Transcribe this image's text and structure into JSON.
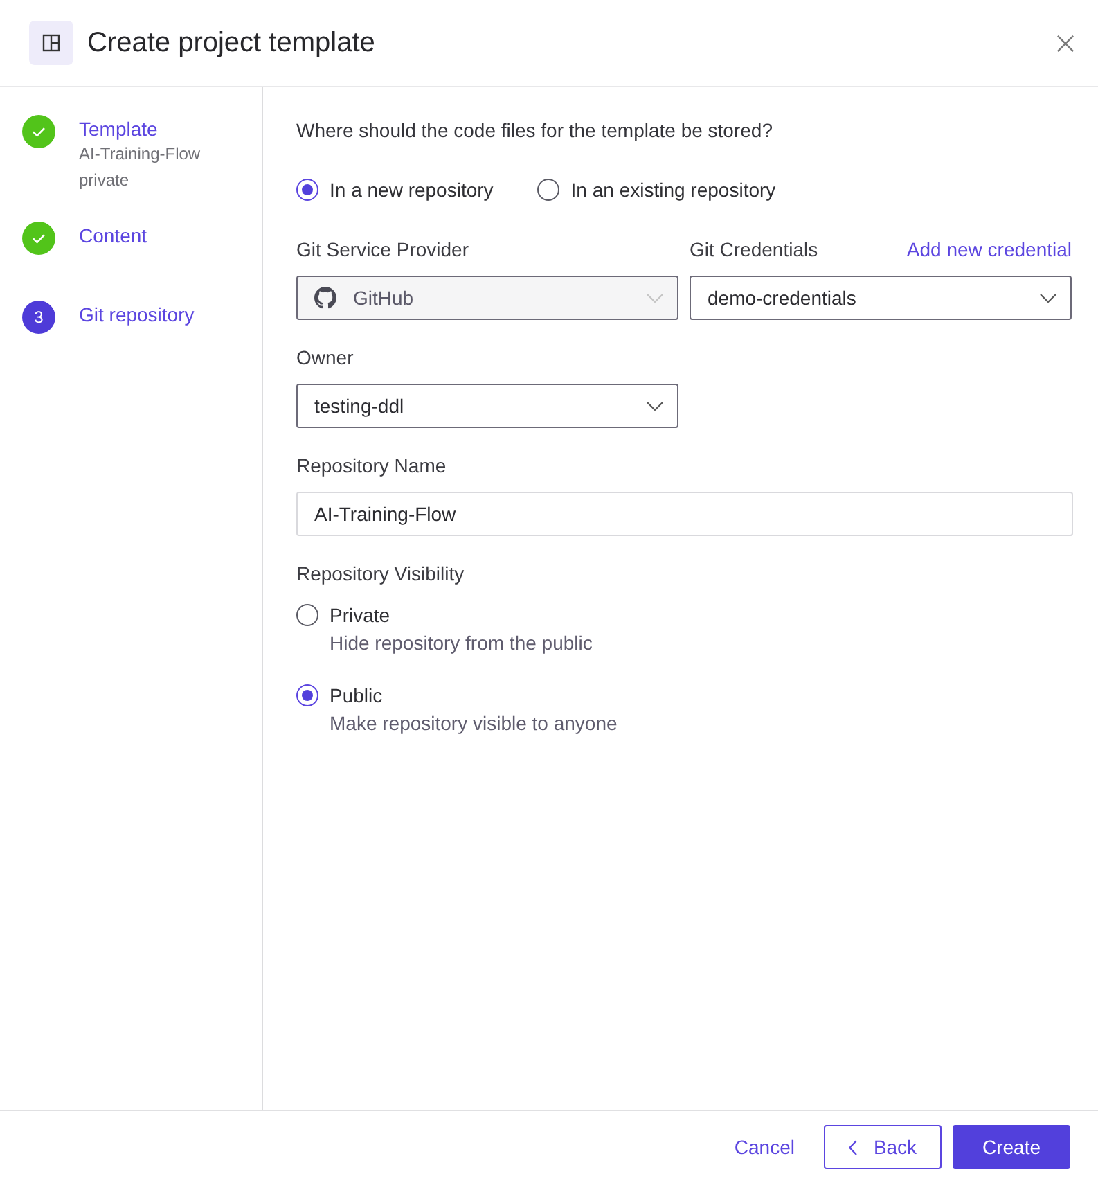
{
  "dialog": {
    "title": "Create project template"
  },
  "steps": [
    {
      "label": "Template",
      "details": [
        "AI-Training-Flow",
        "private"
      ],
      "completed": true,
      "selected": false
    },
    {
      "label": "Content",
      "completed": true,
      "selected": false
    },
    {
      "label": "Git repository",
      "number": "3",
      "completed": false,
      "selected": true
    }
  ],
  "question": "Where should the code files for the template be stored?",
  "storage_options": [
    {
      "label": "In a new repository",
      "selected": true
    },
    {
      "label": "In an existing repository",
      "selected": false
    }
  ],
  "provider": {
    "label": "Git Service Provider",
    "value": "GitHub",
    "disabled": true
  },
  "credentials": {
    "label": "Git Credentials",
    "link": "Add new credential",
    "value": "demo-credentials",
    "disabled": false
  },
  "owner": {
    "label": "Owner",
    "value": "testing-ddl",
    "disabled": false
  },
  "repository_name": {
    "label": "Repository Name",
    "value": "AI-Training-Flow"
  },
  "visibility": {
    "label": "Repository Visibility",
    "options": [
      {
        "label": "Private",
        "description": "Hide repository from the public",
        "selected": false
      },
      {
        "label": "Public",
        "description": "Make repository visible to anyone",
        "selected": true
      }
    ]
  },
  "footer": {
    "buttons": [
      {
        "label": "Cancel",
        "kind": "link"
      },
      {
        "label": "Back",
        "kind": "secondary"
      },
      {
        "label": "Create",
        "kind": "primary"
      }
    ]
  }
}
